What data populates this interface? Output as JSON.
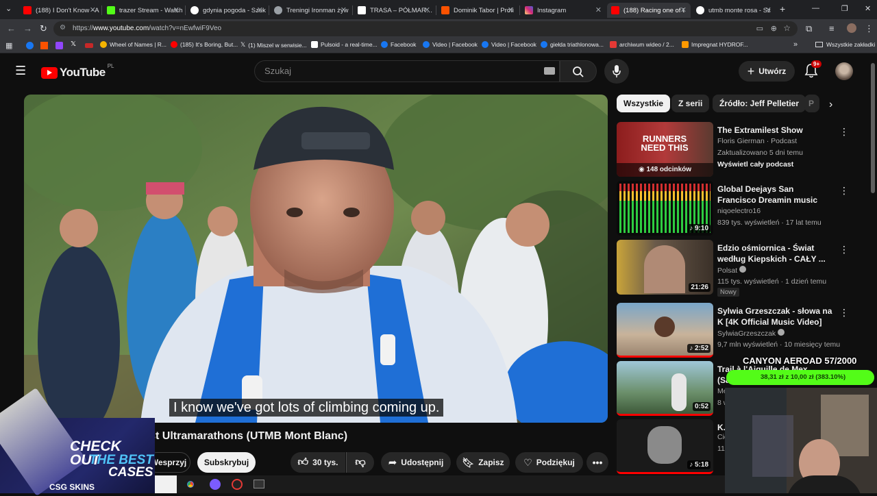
{
  "browser": {
    "tabs": [
      {
        "label": "(188) I Don't Know - A",
        "color": "#ff0000"
      },
      {
        "label": "trazer Stream - Watch",
        "color": "#53fc18"
      },
      {
        "label": "gdynia pogoda - Szuk",
        "color": "#ffffff"
      },
      {
        "label": "Treningi Ironman żyw",
        "color": "#9aa0a6"
      },
      {
        "label": "TRASA – PÓŁMARATO",
        "color": "#ffffff"
      },
      {
        "label": "Dominik Tabor | Profi",
        "color": "#fc5200"
      },
      {
        "label": "Instagram",
        "color": "#e1306c"
      },
      {
        "label": "(188) Racing one of t",
        "color": "#ff0000"
      },
      {
        "label": "utmb monte rosa - Sz",
        "color": "#ffffff"
      }
    ],
    "url_prefix": "https://",
    "url_host": "www.youtube.com",
    "url_path": "/watch?v=nEwfwiF9Veo",
    "bookmarks": [
      {
        "label": "Wheel of Names | R...",
        "color": "#f4b400"
      },
      {
        "label": "(185) It's Boring, But...",
        "color": "#ff0000"
      },
      {
        "label": "(1) Miszel w serwisie...",
        "color": "#ffffff"
      },
      {
        "label": "Pulsoid - a real-time...",
        "color": "#ffffff"
      },
      {
        "label": "Facebook",
        "color": "#1877f2"
      },
      {
        "label": "Video | Facebook",
        "color": "#1877f2"
      },
      {
        "label": "Video | Facebook",
        "color": "#1877f2"
      },
      {
        "label": "giełda triathlonowa...",
        "color": "#1877f2"
      },
      {
        "label": "archiwum wideo / 2...",
        "color": "#e53935"
      },
      {
        "label": "Impregnat HYDROF...",
        "color": "#ff9900"
      }
    ],
    "all_bookmarks": "Wszystkie zakładki"
  },
  "youtube": {
    "logo": "YouTube",
    "region": "PL",
    "search_placeholder": "Szukaj",
    "create_label": "Utwórz",
    "notif_badge": "9+"
  },
  "video": {
    "caption": "I know we've got lots of climbing coming up.",
    "title": "Racing one of the Biggest Ultramarathons (UTMB Mont Blanc)",
    "support_label": "Wesprzyj",
    "subscribe_label": "Subskrybuj",
    "likes": "30 tys.",
    "share_label": "Udostępnij",
    "save_label": "Zapisz",
    "thanks_label": "Podziękuj"
  },
  "chips": [
    "Wszystkie",
    "Z serii",
    "Źródło: Jeff Pelletier",
    "P"
  ],
  "recommendations": [
    {
      "title": "The Extramilest Show",
      "channel": "Floris Gierman · Podcast",
      "meta": "Zaktualizowano 5 dni temu",
      "extra": "Wyświetl cały podcast",
      "duration": "148 odcinków",
      "thumb_text": "RUNNERS NEED THIS"
    },
    {
      "title": "Global Deejays San Francisco Dreamin music only",
      "channel": "niqoelectro16",
      "meta": "839 tys. wyświetleń · 17 lat temu",
      "duration": "9:10"
    },
    {
      "title": "Edzio ośmiornica - Świat według Kiepskich - CAŁY ...",
      "channel": "Polsat",
      "meta": "115 tys. wyświetleń · 1 dzień temu",
      "badge": "Nowy",
      "duration": "21:26"
    },
    {
      "title": "Sylwia Grzeszczak - słowa na K [4K Official Music Video]",
      "channel": "SylwiaGrzeszczak",
      "meta": "9,7 mln wyświetleń · 10 miesięcy temu",
      "duration": "2:52"
    },
    {
      "title": "Trail à l'Aiguille de Mex (Saint-Maurice)",
      "channel": "Me",
      "meta": "8 w",
      "duration": "0:52"
    },
    {
      "title": "K.",
      "channel": "Cie",
      "meta": "11",
      "duration": "5:18"
    }
  ],
  "overlay": {
    "stream_title": "CANYON AEROAD 57/2000",
    "stream_progress_text": "38,31 zł z 10,00 zł (383.10%)",
    "ad_line1": "CHECK OUT",
    "ad_line2": "THE BEST",
    "ad_line3": "CASES",
    "ad_brand": "CSG SKINS"
  }
}
